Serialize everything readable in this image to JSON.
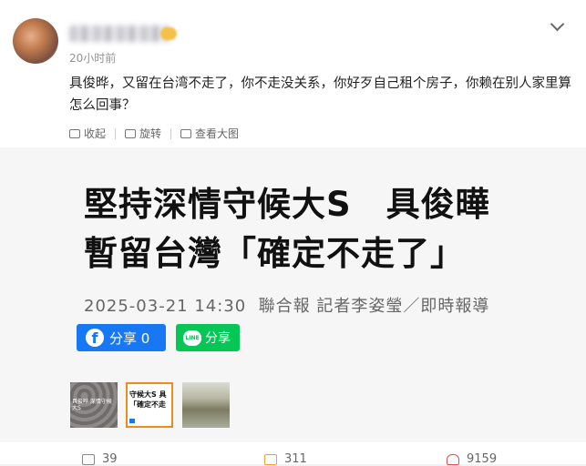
{
  "post": {
    "time": "20小时前",
    "text": "具俊晔，又留在台湾不走了，你不走没关系，你好歹自己租个房子，你赖在别人家里算怎么回事？"
  },
  "actions": {
    "collapse": "收起",
    "rotate": "旋转",
    "view_large": "查看大图"
  },
  "article": {
    "headline_line1": "堅持深情守候大S　具俊曄",
    "headline_line2": "暫留台灣「確定不走了」",
    "byline": "2025-03-21 14:30  聯合報 記者李姿瑩／即時報導",
    "fb_logo": "f",
    "fb_share": "分享 0",
    "line_logo": "LINE",
    "line_share": "分享"
  },
  "thumbnails": [
    {
      "caption": "具俊晔 深情守候大S"
    },
    {
      "caption": "守候大S 具\n「確定不走"
    },
    {
      "caption": ""
    }
  ],
  "footer": {
    "forward_count": "39",
    "comment_count": "311",
    "like_count": "9159"
  },
  "colors": {
    "facebook": "#1877f2",
    "line": "#06c755",
    "selected_thumb_border": "#f08a1c"
  }
}
